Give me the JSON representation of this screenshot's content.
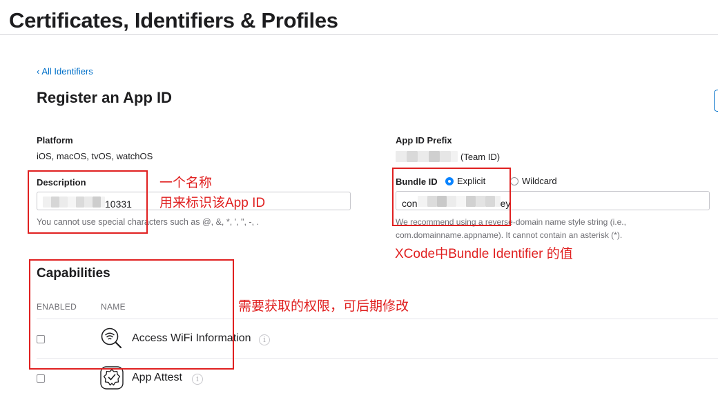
{
  "header": {
    "title": "Certificates, Identifiers & Profiles"
  },
  "nav": {
    "back_chevron": "‹",
    "back_label": "All Identifiers"
  },
  "page": {
    "section_title": "Register an App ID"
  },
  "platform": {
    "label": "Platform",
    "value": "iOS, macOS, tvOS, watchOS"
  },
  "app_id_prefix": {
    "label": "App ID Prefix",
    "suffix": "(Team ID)"
  },
  "description": {
    "label": "Description",
    "value_visible": "10331",
    "hint": "You cannot use special characters such as @, &, *, ', \", -, ."
  },
  "bundle_id": {
    "label": "Bundle ID",
    "options": [
      {
        "label": "Explicit",
        "selected": true
      },
      {
        "label": "Wildcard",
        "selected": false
      }
    ],
    "value_prefix": "con",
    "value_suffix": "ey",
    "hint_line1": "We recommend using a reverse-domain name style string (i.e.,",
    "hint_line2": "com.domainname.appname). It cannot contain an asterisk (*)."
  },
  "annotations": {
    "name_line1": "一个名称",
    "name_line2": "用来标识该App ID",
    "bundle_note": "XCode中Bundle Identifier 的值",
    "capabilities_note": "需要获取的权限，可后期修改",
    "color": "#e02020"
  },
  "capabilities": {
    "title": "Capabilities",
    "col_enabled": "ENABLED",
    "col_name": "NAME",
    "items": [
      {
        "name": "Access WiFi Information",
        "icon": "wifi-magnifier-icon",
        "enabled": false
      },
      {
        "name": "App Attest",
        "icon": "attest-badge-icon",
        "enabled": false
      }
    ]
  },
  "colors": {
    "accent": "#0070c9",
    "radio_selected": "#0a84ff",
    "text": "#1d1d1f",
    "hint": "#6e6e73"
  }
}
